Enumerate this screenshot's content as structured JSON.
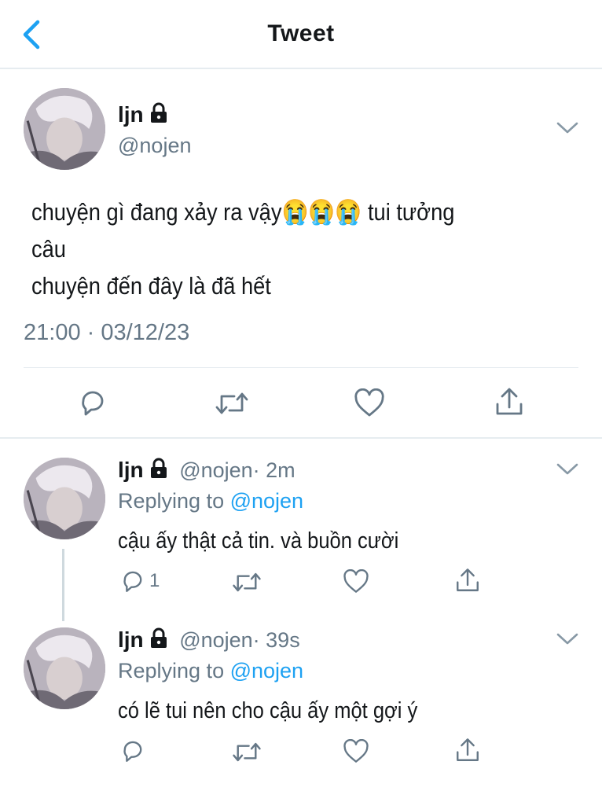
{
  "header": {
    "title": "Tweet"
  },
  "main_tweet": {
    "name": "ljn",
    "handle": "@nojen",
    "text_line1": "chuyện gì đang xảy ra vậy😭😭😭 tui tưởng câu",
    "text_line2": "chuyện đến đây là đã hết",
    "timestamp": "21:00 · 03/12/23"
  },
  "replies": [
    {
      "name": "ljn",
      "handle": "@nojen",
      "time": "· 2m",
      "replying_prefix": "Replying to ",
      "replying_handle": "@nojen",
      "text": "cậu ấy thật cả tin. và buồn cười",
      "reply_count": "1"
    },
    {
      "name": "ljn",
      "handle": "@nojen",
      "time": "· 39s",
      "replying_prefix": "Replying to ",
      "replying_handle": "@nojen",
      "text": "có lẽ tui nên cho cậu ấy một gợi ý",
      "reply_count": ""
    }
  ],
  "colors": {
    "accent": "#1da1f2",
    "secondary_text": "#657786",
    "icon": "#657786",
    "divider": "#e6ecf0"
  },
  "icons": [
    "chevron-left-icon",
    "lock-icon",
    "chevron-down-icon",
    "reply-icon",
    "retweet-icon",
    "like-icon",
    "share-icon"
  ]
}
